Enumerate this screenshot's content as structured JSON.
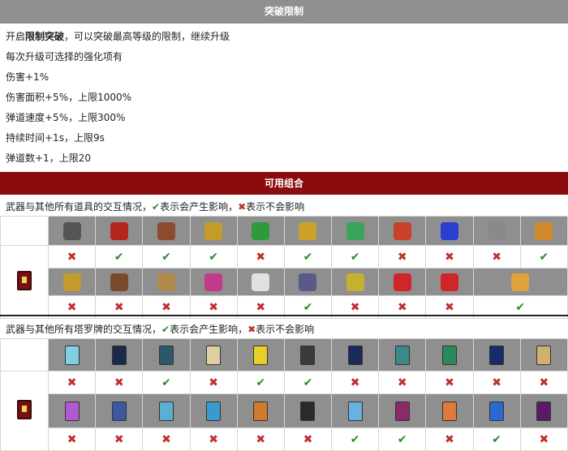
{
  "section1": {
    "title": "突破限制",
    "intro_prefix": "开启",
    "intro_bold": "限制突破",
    "intro_suffix": "，可以突破最高等级的限制，继续升级",
    "lines": [
      "每次升级可选择的强化项有",
      "伤害+1%",
      "伤害面积+5%，上限1000%",
      "弹道速度+5%，上限300%",
      "持续时间+1s，上限9s",
      "弹道数+1，上限20"
    ]
  },
  "section2": {
    "title": "可用组合",
    "items_note": {
      "prefix": "武器与其他所有道具的交互情况，",
      "ok_text": "表示会产生影响，",
      "no_text": "表示不会影响"
    },
    "tarot_note": {
      "prefix": "武器与其他所有塔罗牌的交互情况，",
      "ok_text": "表示会产生影响，",
      "no_text": "表示不会影响"
    },
    "marks": {
      "ok": "✔",
      "no": "✖"
    },
    "items_row1": [
      {
        "icon": "heart-frame-icon",
        "color": "#555555",
        "mark": "no"
      },
      {
        "icon": "red-tome-icon",
        "color": "#b3261e",
        "mark": "ok"
      },
      {
        "icon": "gauntlet-icon",
        "color": "#8a4b2f",
        "mark": "ok"
      },
      {
        "icon": "candelabra-icon",
        "color": "#c49a2a",
        "mark": "ok"
      },
      {
        "icon": "clover-icon",
        "color": "#2e9a3a",
        "mark": "no"
      },
      {
        "icon": "crown-icon",
        "color": "#c9a227",
        "mark": "ok"
      },
      {
        "icon": "feather-icon",
        "color": "#3aa55a",
        "mark": "ok"
      },
      {
        "icon": "hollow-heart-icon",
        "color": "#c8412b",
        "mark": "no"
      },
      {
        "icon": "blue-orb-icon",
        "color": "#2a3fd0",
        "mark": "no"
      },
      {
        "icon": "silver-ring-icon",
        "color": "#8a8a8a",
        "mark": "no"
      },
      {
        "icon": "gold-ring-icon",
        "color": "#d08a2a",
        "mark": "ok"
      }
    ],
    "items_row2": [
      {
        "icon": "shield-crown-icon",
        "color": "#c49a2a",
        "mark": "no"
      },
      {
        "icon": "cake-icon",
        "color": "#7a4a2a",
        "mark": "no"
      },
      {
        "icon": "helmet-icon",
        "color": "#b08a4a",
        "mark": "no"
      },
      {
        "icon": "skull-icon",
        "color": "#c23a8a",
        "mark": "no"
      },
      {
        "icon": "wings-icon",
        "color": "#e0e0e0",
        "mark": "no"
      },
      {
        "icon": "metal-ring-icon",
        "color": "#5a5a8a",
        "mark": "ok"
      },
      {
        "icon": "gold-band-icon",
        "color": "#c7b030",
        "mark": "no"
      },
      {
        "icon": "red-arrow-icon",
        "color": "#d0262a",
        "mark": "no"
      },
      {
        "icon": "red-arrow-left-icon",
        "color": "#d0262a",
        "mark": "no"
      },
      {
        "icon": "scroll-icon",
        "color": "#e0a23a",
        "mark": "ok"
      }
    ],
    "tarot_row1": [
      {
        "icon": "tarot-frost-icon",
        "color": "#7fd0e0",
        "mark": "no"
      },
      {
        "icon": "tarot-tower-icon",
        "color": "#1a2a4a",
        "mark": "no"
      },
      {
        "icon": "tarot-wheel-icon",
        "color": "#2a5a6a",
        "mark": "ok"
      },
      {
        "icon": "tarot-crown-icon",
        "color": "#e0d0a0",
        "mark": "no"
      },
      {
        "icon": "tarot-sun-icon",
        "color": "#e8d02a",
        "mark": "ok"
      },
      {
        "icon": "tarot-spider-icon",
        "color": "#3a3a3a",
        "mark": "ok"
      },
      {
        "icon": "tarot-wheel-dark-icon",
        "color": "#1a2a5a",
        "mark": "no"
      },
      {
        "icon": "tarot-hand-icon",
        "color": "#3a8a8a",
        "mark": "no"
      },
      {
        "icon": "tarot-tree-icon",
        "color": "#2a8a5a",
        "mark": "no"
      },
      {
        "icon": "tarot-cross-icon",
        "color": "#1a2a6a",
        "mark": "no"
      },
      {
        "icon": "tarot-mirror-icon",
        "color": "#d0b070",
        "mark": "no"
      }
    ],
    "tarot_row2": [
      {
        "icon": "tarot-wave-icon",
        "color": "#b05ad0",
        "mark": "no"
      },
      {
        "icon": "tarot-moon-icon",
        "color": "#3a5aa0",
        "mark": "no"
      },
      {
        "icon": "tarot-loop-icon",
        "color": "#5ab0d0",
        "mark": "no"
      },
      {
        "icon": "tarot-eye-icon",
        "color": "#3a9ad0",
        "mark": "no"
      },
      {
        "icon": "tarot-mask-icon",
        "color": "#d07a2a",
        "mark": "no"
      },
      {
        "icon": "tarot-blade-icon",
        "color": "#2a2a2a",
        "mark": "no"
      },
      {
        "icon": "tarot-storm-icon",
        "color": "#6ab0e0",
        "mark": "ok"
      },
      {
        "icon": "tarot-figure-icon",
        "color": "#8a2a6a",
        "mark": "ok"
      },
      {
        "icon": "tarot-sunset-icon",
        "color": "#e07a3a",
        "mark": "no"
      },
      {
        "icon": "tarot-bird-icon",
        "color": "#2a6ad0",
        "mark": "ok"
      },
      {
        "icon": "tarot-flame-icon",
        "color": "#5a1a6a",
        "mark": "no"
      }
    ]
  },
  "colors": {
    "ok": "#2a8a2a",
    "no": "#c0302c",
    "header_red": "#8b0c0c",
    "header_gray": "#8f8f8f"
  }
}
